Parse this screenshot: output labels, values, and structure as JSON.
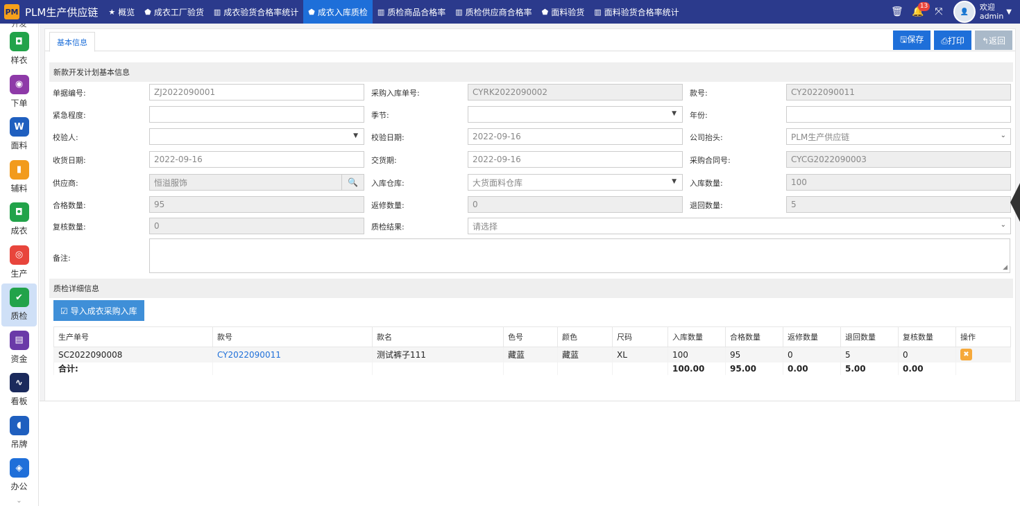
{
  "app": {
    "logo": "PM",
    "brand": "PLM生产供应链"
  },
  "nav": [
    {
      "icon": "★",
      "label": "概览",
      "active": false
    },
    {
      "icon": "⬟",
      "label": "成衣工厂验货",
      "active": false
    },
    {
      "icon": "▥",
      "label": "成衣验货合格率统计",
      "active": false
    },
    {
      "icon": "⬟",
      "label": "成衣入库质检",
      "active": true
    },
    {
      "icon": "▥",
      "label": "质检商品合格率",
      "active": false
    },
    {
      "icon": "▥",
      "label": "质检供应商合格率",
      "active": false
    },
    {
      "icon": "⬟",
      "label": "面料验货",
      "active": false
    },
    {
      "icon": "▥",
      "label": "面料验货合格率统计",
      "active": false
    }
  ],
  "topright": {
    "notifications": "13",
    "welcome": "欢迎",
    "user": "admin"
  },
  "sidebar": {
    "top_label": "开发",
    "items": [
      {
        "label": "样衣",
        "color": "#22a34a",
        "glyph": "◘"
      },
      {
        "label": "下单",
        "color": "#8e3aa8",
        "glyph": "◉"
      },
      {
        "label": "面料",
        "color": "#1f5fbf",
        "glyph": "W"
      },
      {
        "label": "辅料",
        "color": "#f29b1d",
        "glyph": "▮"
      },
      {
        "label": "成衣",
        "color": "#22a34a",
        "glyph": "◘"
      },
      {
        "label": "生产",
        "color": "#e8453c",
        "glyph": "◎"
      },
      {
        "label": "质检",
        "color": "#22a34a",
        "glyph": "✔",
        "active": true
      },
      {
        "label": "资金",
        "color": "#6a3aa8",
        "glyph": "▤"
      },
      {
        "label": "看板",
        "color": "#1b2a5c",
        "glyph": "∿"
      },
      {
        "label": "吊牌",
        "color": "#1f5fbf",
        "glyph": "◖"
      },
      {
        "label": "办公",
        "color": "#1f6fd9",
        "glyph": "◈"
      }
    ],
    "more": "⌄"
  },
  "tabs": {
    "basic": "基本信息"
  },
  "buttons": {
    "save": "🖫保存",
    "print": "⎙打印",
    "back": "↰返回"
  },
  "sections": {
    "basic": "新款开发计划基本信息",
    "detail": "质检详细信息"
  },
  "form": {
    "doc_no": {
      "label": "单据编号:",
      "value": "ZJ2022090001"
    },
    "purchase_no": {
      "label": "采购入库单号:",
      "value": "CYRK2022090002"
    },
    "style_no": {
      "label": "款号:",
      "value": "CY2022090011"
    },
    "urgency": {
      "label": "紧急程度:",
      "value": ""
    },
    "season": {
      "label": "季节:",
      "value": ""
    },
    "year": {
      "label": "年份:",
      "value": ""
    },
    "inspector": {
      "label": "校验人:",
      "value": ""
    },
    "inspect_date": {
      "label": "校验日期:",
      "value": "2022-09-16"
    },
    "company": {
      "label": "公司抬头:",
      "value": "PLM生产供应链"
    },
    "receive_date": {
      "label": "收货日期:",
      "value": "2022-09-16"
    },
    "delivery": {
      "label": "交货期:",
      "value": "2022-09-16"
    },
    "contract_no": {
      "label": "采购合同号:",
      "value": "CYCG2022090003"
    },
    "supplier": {
      "label": "供应商:",
      "value": "恒溢服饰"
    },
    "warehouse": {
      "label": "入库仓库:",
      "value": "大货面料仓库"
    },
    "in_qty": {
      "label": "入库数量:",
      "value": "100"
    },
    "pass_qty": {
      "label": "合格数量:",
      "value": "95"
    },
    "repair_qty": {
      "label": "返修数量:",
      "value": "0"
    },
    "return_qty": {
      "label": "退回数量:",
      "value": "5"
    },
    "recheck_qty": {
      "label": "复核数量:",
      "value": "0"
    },
    "result": {
      "label": "质检结果:",
      "value": "请选择"
    },
    "remark": {
      "label": "备注:",
      "value": ""
    }
  },
  "import_button": "☑ 导入成衣采购入库",
  "table": {
    "headers": [
      "生产单号",
      "款号",
      "款名",
      "色号",
      "颜色",
      "尺码",
      "入库数量",
      "合格数量",
      "返修数量",
      "退回数量",
      "复核数量",
      "操作"
    ],
    "rows": [
      [
        "SC2022090008",
        "CY2022090011",
        "测试裤子111",
        "藏蓝",
        "藏蓝",
        "XL",
        "100",
        "95",
        "0",
        "5",
        "0"
      ]
    ],
    "total": {
      "label": "合计:",
      "in": "100.00",
      "pass": "95.00",
      "repair": "0.00",
      "return": "5.00",
      "recheck": "0.00"
    },
    "delete_glyph": "✖"
  }
}
